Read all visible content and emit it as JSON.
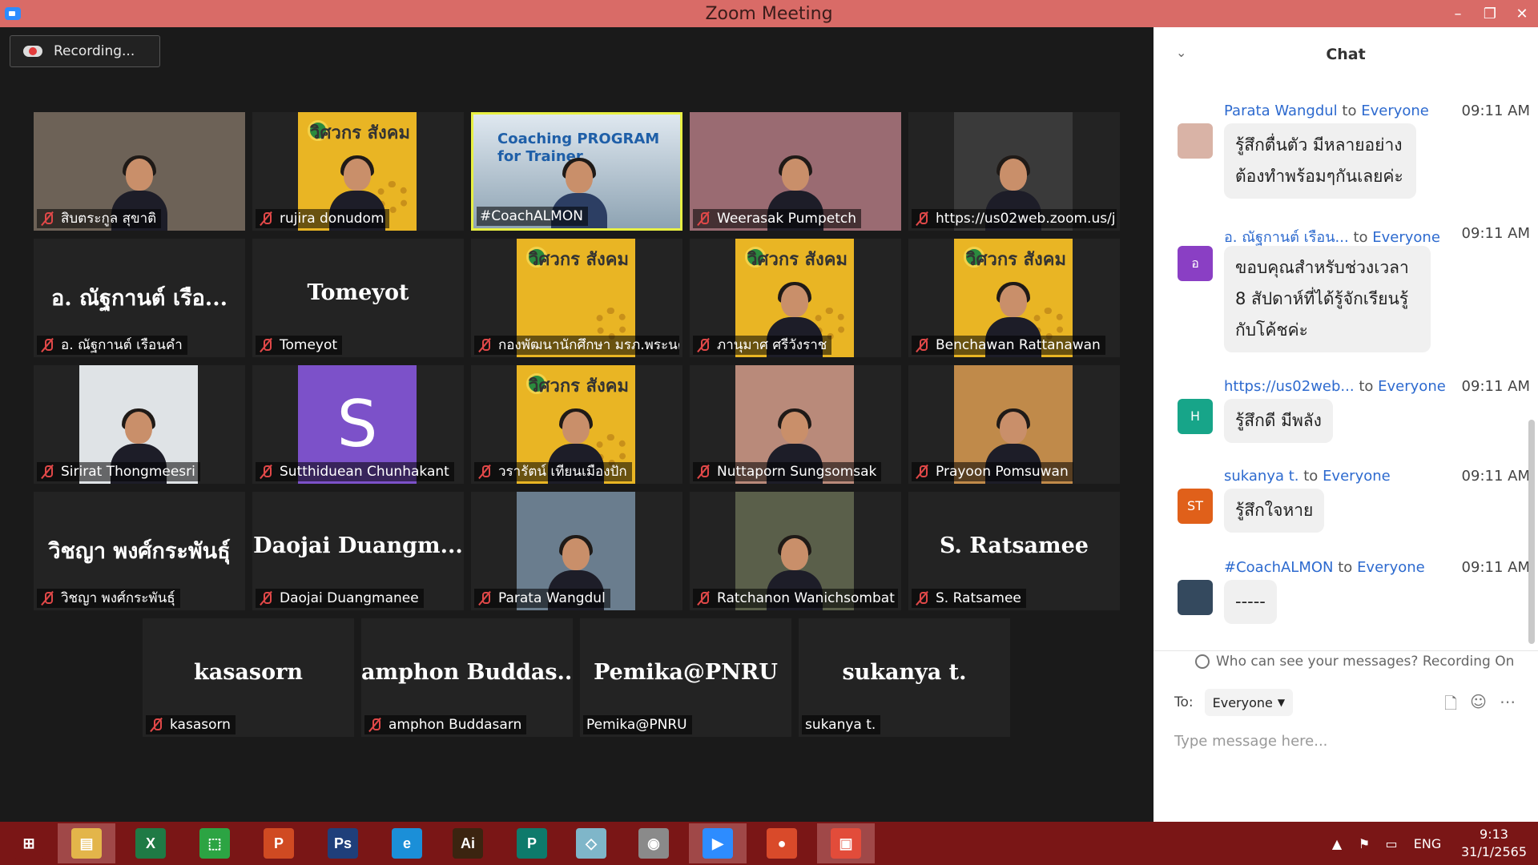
{
  "window": {
    "title": "Zoom Meeting",
    "minimize_icon": "–",
    "restore_icon": "❐",
    "close_icon": "✕"
  },
  "recording": {
    "label": "Recording..."
  },
  "tiles": [
    {
      "label": "สิบตระกูล สุขาติ",
      "big": ""
    },
    {
      "label": "rujira donudom",
      "big": ""
    },
    {
      "label": "#CoachALMON",
      "big": ""
    },
    {
      "label": "Weerasak Pumpetch",
      "big": ""
    },
    {
      "label": "https://us02web.zoom.us/j...",
      "big": ""
    },
    {
      "label": "อ. ณัฐกานต์ เรือนคำ",
      "big": "อ. ณัฐกานต์  เรือ..."
    },
    {
      "label": "Tomeyot",
      "big": "Tomeyot"
    },
    {
      "label": "กองพัฒนานักศึกษา มรภ.พระนคร",
      "big": ""
    },
    {
      "label": "ภานุมาศ ศรีวังราช",
      "big": ""
    },
    {
      "label": "Benchawan Rattanawan",
      "big": ""
    },
    {
      "label": "Sirirat Thongmeesri",
      "big": ""
    },
    {
      "label": "Sutthiduean Chunhakant",
      "big": "",
      "avatar": "S"
    },
    {
      "label": "วรารัตน์ เทียนเมืองปัก",
      "big": ""
    },
    {
      "label": "Nuttaporn Sungsomsak",
      "big": ""
    },
    {
      "label": "Prayoon Pomsuwan",
      "big": ""
    },
    {
      "label": "วิชญา พงศ์กระพันธุ์",
      "big": "วิชญา พงศ์กระพันธุ์"
    },
    {
      "label": "Daojai Duangmanee",
      "big": "Daojai  Duangm..."
    },
    {
      "label": "Parata Wangdul",
      "big": ""
    },
    {
      "label": "Ratchanon Wanichsombat",
      "big": ""
    },
    {
      "label": "S. Ratsamee",
      "big": "S. Ratsamee"
    },
    {
      "label": "kasasorn",
      "big": "kasasorn"
    },
    {
      "label": "amphon Buddasarn",
      "big": "amphon  Buddas..."
    },
    {
      "label": "Pemika@PNRU",
      "big": "Pemika@PNRU"
    },
    {
      "label": "sukanya t.",
      "big": "sukanya t."
    }
  ],
  "poster_text": "วิศวกร สังคม",
  "banner_text": "Coaching PROGRAM for Trainer",
  "chat": {
    "title": "Chat",
    "to_word": "to",
    "messages": [
      {
        "sender": "Parata Wangdul",
        "to": "Everyone",
        "time": "09:11 AM",
        "text": "รู้สึกตื่นตัว มีหลายอย่างต้องทำพร้อมๆกันเลยค่ะ",
        "avatar": "",
        "avatar_color": "#d9b3a6"
      },
      {
        "sender": "อ. ณัฐกานต์ เรือน...",
        "to": "Everyone",
        "time": "09:11 AM",
        "text": "ขอบคุณสำหรับช่วงเวลา 8 สัปดาห์ที่ได้รู้จักเรียนรู้กับโค้ชค่ะ",
        "avatar": "อ",
        "avatar_color": "#8a3fc4"
      },
      {
        "sender": "https://us02web...",
        "to": "Everyone",
        "time": "09:11 AM",
        "text": "รู้สึกดี มีพลัง",
        "avatar": "H",
        "avatar_color": "#17a589"
      },
      {
        "sender": "sukanya t.",
        "to": "Everyone",
        "time": "09:11 AM",
        "text": "รู้สึกใจหาย",
        "avatar": "ST",
        "avatar_color": "#e0601a"
      },
      {
        "sender": "#CoachALMON",
        "to": "Everyone",
        "time": "09:11 AM",
        "text": "-----",
        "avatar": "",
        "avatar_color": "#34495e"
      }
    ],
    "privacy_note": "Who can see your messages? Recording On",
    "to_label": "To:",
    "recipient": "Everyone",
    "input_placeholder": "Type message here..."
  },
  "taskbar": {
    "apps": [
      {
        "name": "start",
        "glyph": "⊞",
        "color": "#7a1616"
      },
      {
        "name": "file-explorer",
        "glyph": "▤",
        "color": "#e3b54a"
      },
      {
        "name": "excel",
        "glyph": "X",
        "color": "#1f7a45"
      },
      {
        "name": "store",
        "glyph": "⬚",
        "color": "#2ca443"
      },
      {
        "name": "powerpoint",
        "glyph": "P",
        "color": "#d04a22"
      },
      {
        "name": "photoshop",
        "glyph": "Ps",
        "color": "#1f3f7a"
      },
      {
        "name": "internet-explorer",
        "glyph": "e",
        "color": "#1b8fd8"
      },
      {
        "name": "illustrator",
        "glyph": "Ai",
        "color": "#3b2410"
      },
      {
        "name": "publisher",
        "glyph": "P",
        "color": "#0e7a6b"
      },
      {
        "name": "eraser",
        "glyph": "◇",
        "color": "#7fb6c9"
      },
      {
        "name": "photoscape",
        "glyph": "◉",
        "color": "#8a8a8a"
      },
      {
        "name": "zoom",
        "glyph": "▶",
        "color": "#2d8cff"
      },
      {
        "name": "chrome",
        "glyph": "●",
        "color": "#d94a2a"
      },
      {
        "name": "presentation",
        "glyph": "▣",
        "color": "#e24c3a"
      }
    ],
    "tray": {
      "chevron": "▲",
      "flag": "⚑",
      "network": "▭",
      "language": "ENG",
      "time": "9:13",
      "date": "31/1/2565"
    }
  }
}
